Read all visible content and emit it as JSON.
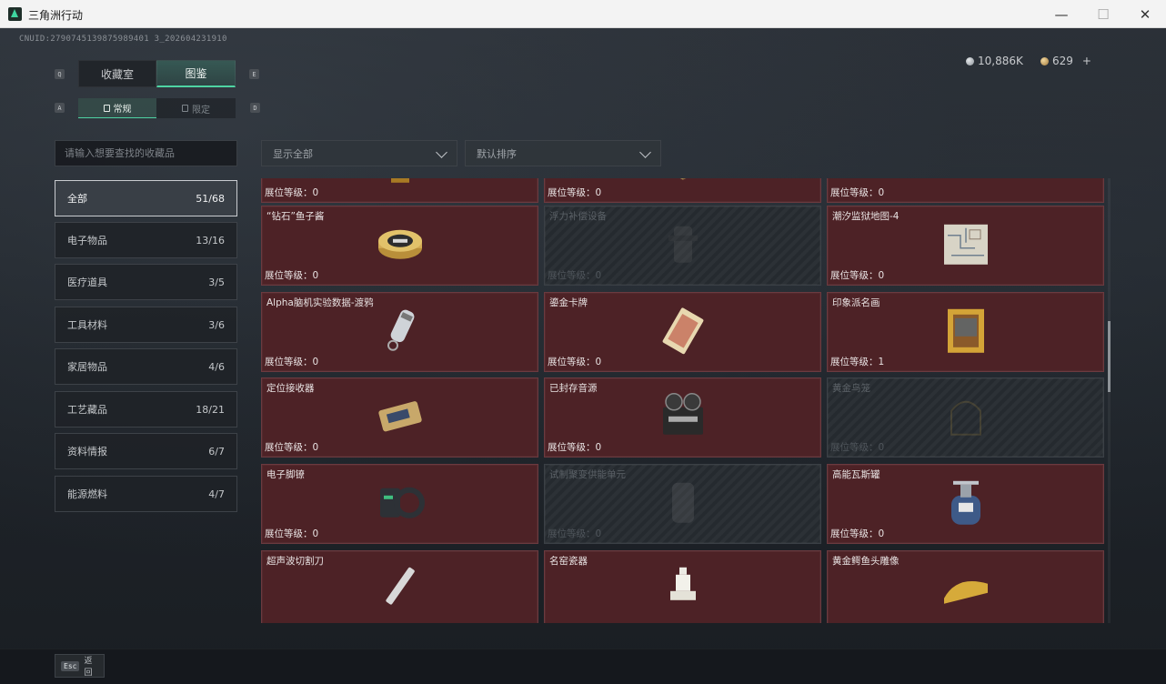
{
  "window": {
    "title": "三角洲行动",
    "min": "—",
    "max": "☐",
    "close": "✕"
  },
  "uid": "CNUID:2790745139875989401 3_202604231910",
  "currency": [
    {
      "icon": "silver-coin-icon",
      "amount": "10,886K"
    },
    {
      "icon": "gold-coin-icon",
      "amount": "629",
      "action": "+"
    }
  ],
  "tabs": [
    {
      "label": "收藏室",
      "key": "Q"
    },
    {
      "label": "图鉴",
      "key": "E"
    }
  ],
  "subtabs": [
    {
      "label": "常规",
      "key": "A"
    },
    {
      "label": "限定",
      "key": "D"
    }
  ],
  "search": {
    "placeholder": "请输入想要查找的收藏品"
  },
  "filters": {
    "show": "显示全部",
    "sort": "默认排序"
  },
  "categories": [
    {
      "label": "全部",
      "count": "51/68"
    },
    {
      "label": "电子物品",
      "count": "13/16"
    },
    {
      "label": "医疗道具",
      "count": "3/5"
    },
    {
      "label": "工具材料",
      "count": "3/6"
    },
    {
      "label": "家居物品",
      "count": "4/6"
    },
    {
      "label": "工艺藏品",
      "count": "18/21"
    },
    {
      "label": "资料情报",
      "count": "6/7"
    },
    {
      "label": "能源燃料",
      "count": "4/7"
    }
  ],
  "level_label": "展位等级：",
  "items": [
    {
      "name": "",
      "level": "0",
      "icon": "armillary-sphere-icon"
    },
    {
      "name": "",
      "level": "0",
      "icon": "chess-box-icon"
    },
    {
      "name": "",
      "level": "0",
      "icon": "mech-device-icon"
    },
    {
      "name": "“钻石”鱼子酱",
      "level": "0",
      "icon": "caviar-tin-icon"
    },
    {
      "name": "浮力补偿设备",
      "level": "0",
      "icon": "buoyancy-device-icon",
      "locked": true
    },
    {
      "name": "潮汐监狱地图-4",
      "level": "0",
      "icon": "map-icon"
    },
    {
      "name": "Alpha脑机实验数据-渡鸦",
      "level": "0",
      "icon": "data-canister-icon"
    },
    {
      "name": "鎏金卡牌",
      "level": "0",
      "icon": "gilded-card-icon"
    },
    {
      "name": "印象派名画",
      "level": "1",
      "icon": "painting-icon"
    },
    {
      "name": "定位接收器",
      "level": "0",
      "icon": "receiver-icon"
    },
    {
      "name": "已封存音源",
      "level": "0",
      "icon": "reel-recorder-icon"
    },
    {
      "name": "黄金鸟笼",
      "level": "0",
      "icon": "birdcage-icon",
      "locked": true
    },
    {
      "name": "电子脚镣",
      "level": "0",
      "icon": "ankle-monitor-icon"
    },
    {
      "name": "试制聚变供能单元",
      "level": "0",
      "icon": "fusion-cell-icon",
      "locked": true
    },
    {
      "name": "高能瓦斯罐",
      "level": "0",
      "icon": "gas-canister-icon"
    },
    {
      "name": "超声波切割刀",
      "level": "",
      "icon": "cutter-icon"
    },
    {
      "name": "名窑瓷器",
      "level": "",
      "icon": "chess-piece-icon"
    },
    {
      "name": "黄金鳄鱼头雕像",
      "level": "",
      "icon": "crocodile-statue-icon"
    }
  ],
  "bottom": {
    "esc_key": "Esc",
    "back_label": "返回"
  }
}
